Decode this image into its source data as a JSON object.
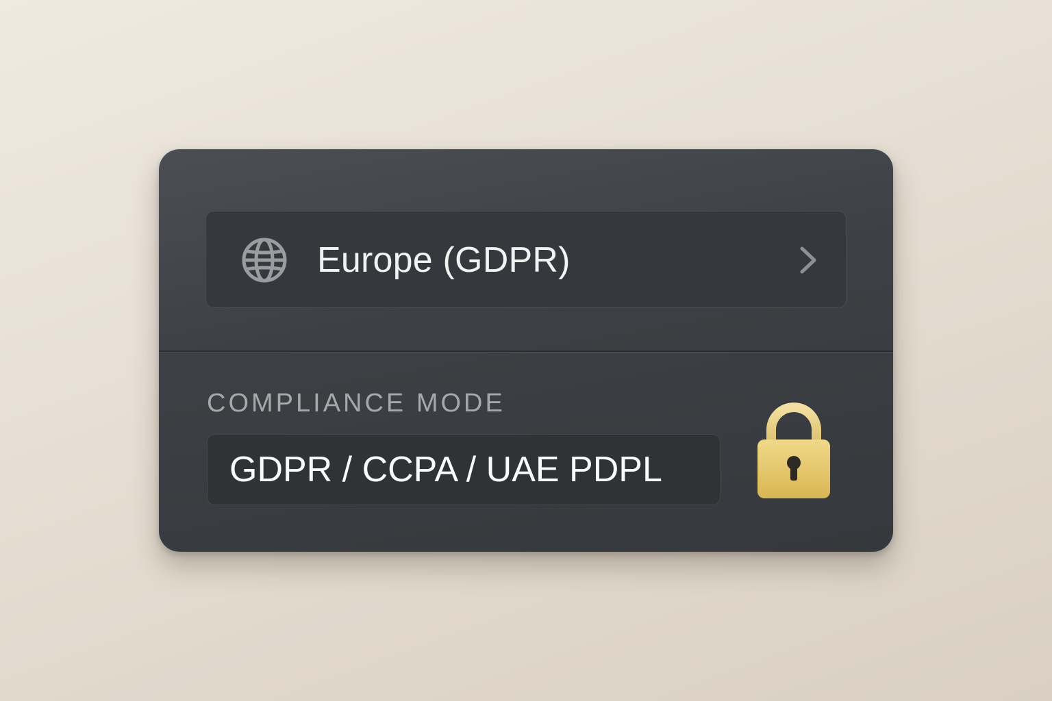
{
  "region_selector": {
    "icon": "globe-icon",
    "label": "Europe (GDPR)",
    "chevron_icon": "chevron-right-icon"
  },
  "compliance": {
    "section_label": "COMPLIANCE MODE",
    "value": "GDPR / CCPA / UAE PDPL",
    "lock_icon": "lock-icon",
    "locked": true
  },
  "colors": {
    "card_background": "#3d4044",
    "lock_gold": "#e3c566",
    "text_primary": "#f2f2f2",
    "text_secondary": "#a6a8ab"
  }
}
